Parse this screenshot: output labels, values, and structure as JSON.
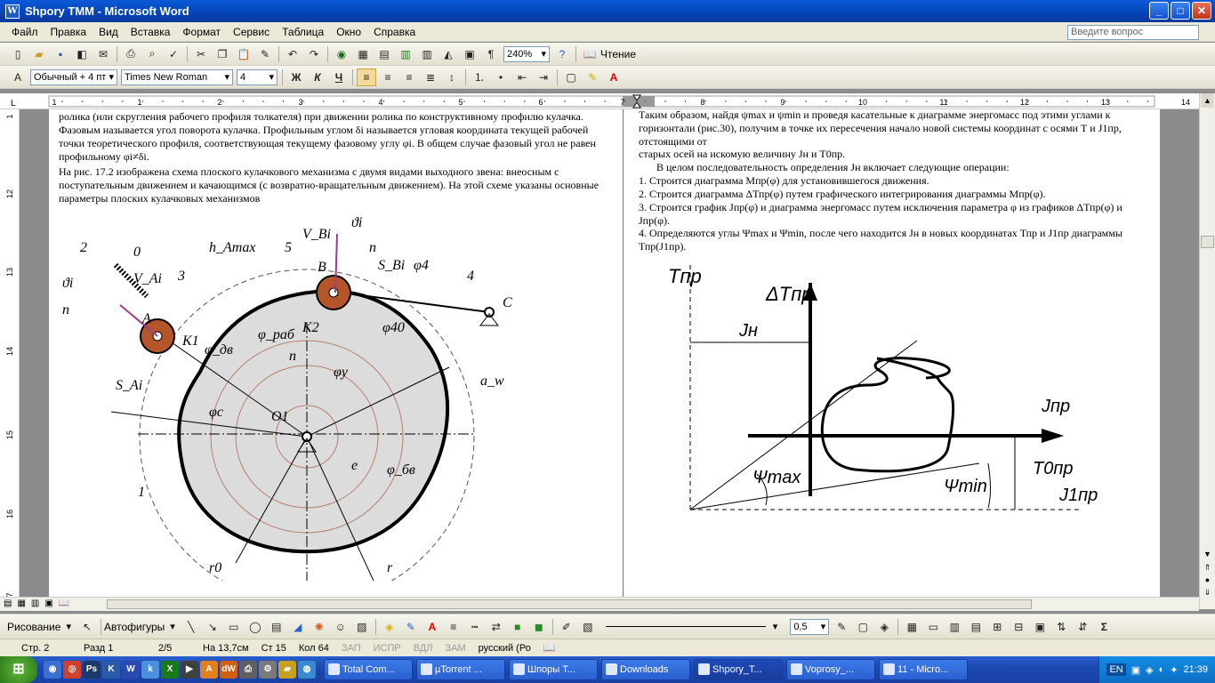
{
  "window": {
    "title": "Shpory  TMM - Microsoft Word",
    "controls": [
      "_",
      "□",
      "✕"
    ]
  },
  "menu": [
    "Файл",
    "Правка",
    "Вид",
    "Вставка",
    "Формат",
    "Сервис",
    "Таблица",
    "Окно",
    "Справка"
  ],
  "help_placeholder": "Введите вопрос",
  "toolbar1": {
    "zoom": "240%",
    "reading_label": "Чтение"
  },
  "toolbar2": {
    "style": "Обычный + 4 пт",
    "font": "Times New Roman",
    "size": "4",
    "bold": "Ж",
    "italic": "К",
    "underline": "Ч"
  },
  "ruler": {
    "h_marks": [
      "1",
      "1",
      "2",
      "3",
      "4",
      "5",
      "6",
      "7",
      "8",
      "9",
      "10",
      "11",
      "12",
      "13",
      "14"
    ],
    "v_marks": [
      "1",
      "12",
      "13",
      "14",
      "15",
      "16",
      "7"
    ]
  },
  "page_left": {
    "paragraph1": "ролика (или скругления рабочего профиля толкателя) при движении ролика по конструктивному профилю кулачка. Фазовым называется угол поворота кулачка. Профильным углом δi называется угловая координата текущей рабочей точки теоретического профиля, соответствующая текущему фазовому углу φi. В общем случае фазовый угол не равен профильному φi≠δi.",
    "paragraph2": "На рис. 17.2 изображена схема плоского кулачкового механизма с двумя видами выходного звена: внеосным с поступательным движением и качающимся (с возвратно-вращательным движением). На этой схеме указаны основные параметры плоских кулачковых механизмов",
    "figure_labels": [
      "2",
      "0",
      "3",
      "h_Amax",
      "5",
      "B",
      "S_Bi",
      "φ4",
      "4",
      "C",
      "ϑi",
      "V_Bi",
      "n",
      "ϑi",
      "n",
      "V_Ai",
      "A",
      "K1",
      "φ_дв",
      "φ_раб",
      "K2",
      "φ40",
      "n",
      "φy",
      "a_w",
      "S_Ai",
      "φc",
      "O1",
      "e",
      "φ_бв",
      "1",
      "r0",
      "r"
    ]
  },
  "page_right": {
    "paragraph1": "Таким образом, найдя  ψmax и ψmin и проведя касательные к диаграмме энергомасс под этими углами к горизонтали (рис.30), получим в точке их пересечения начало новой системы координат  с осями  Т  и J1пр, отстоящими от",
    "paragraph2": "старых осей на искомую величину Jн и Т0пр.",
    "paragraph3": "В целом последовательность определения Jн включает следующие операции:",
    "steps": [
      "1.      Строится диаграмма Мпр(φ) для установившегося движения.",
      "2.      Строится диаграмма ΔТпр(φ) путем графического интегрирования диаграммы Мпр(φ).",
      "3.      Строится график Jпр(φ) и диаграмма энергомасс путем исключения параметра φ из графиков ΔТпр(φ) и Jпр(φ).",
      "4.      Определяются углы Ψmax и Ψmin, после чего находится Jн в новых координатах Тпр и J1пр диаграммы Тпр(J1пр)."
    ],
    "diagram_labels": {
      "t": "Tпр",
      "dt": "ΔTпр",
      "jn": "Jн",
      "j": "Jпр",
      "psimax": "Ψmax",
      "psimin": "Ψmin",
      "t0": "T0пр",
      "j1": "J1пр"
    }
  },
  "drawbar": {
    "draw_label": "Рисование",
    "autoshapes_label": "Автофигуры",
    "line_width": "0,5"
  },
  "status": {
    "page": "Стр. 2",
    "section": "Разд 1",
    "pages": "2/5",
    "at": "На 13,7см",
    "line": "Ст 15",
    "col": "Кол 64",
    "rec": "ЗАП",
    "trk": "ИСПР",
    "ext": "ВДЛ",
    "ovr": "ЗАМ",
    "lang": "русский (Ро"
  },
  "taskbar": {
    "tasks": [
      "Total Com...",
      "µTorrent ...",
      "Шпоры Т...",
      "Downloads",
      "Shpory_T...",
      "Voprosy_...",
      "11 - Micro..."
    ],
    "lang": "EN",
    "time": "21:39"
  },
  "colors": {
    "title": "#0543b6",
    "taskbar": "#2456c4",
    "cam_fill": "#dcdcdc",
    "roller": "#b5562a",
    "arrow": "#9b3c8c",
    "circle": "#b77f6e"
  }
}
